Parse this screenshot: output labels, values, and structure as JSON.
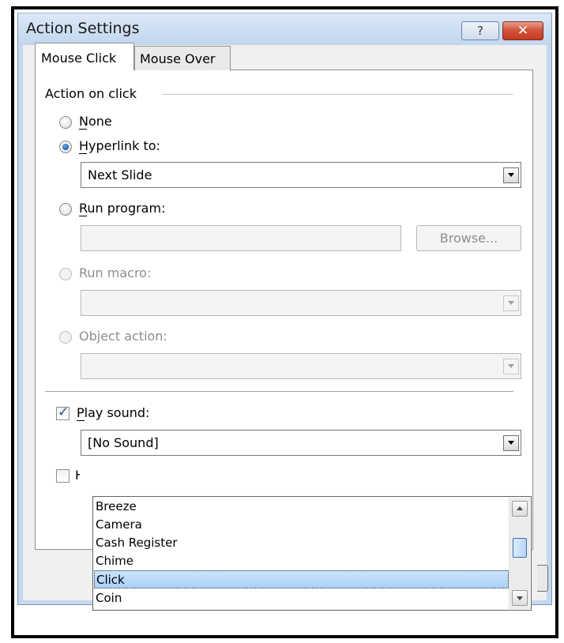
{
  "window": {
    "title": "Action Settings",
    "help_label": "?",
    "close_label": "✕"
  },
  "tabs": [
    {
      "label": "Mouse Click",
      "active": true
    },
    {
      "label": "Mouse Over",
      "active": false
    }
  ],
  "group": {
    "label": "Action on click"
  },
  "options": {
    "none": {
      "label": "None",
      "selected": false,
      "enabled": true
    },
    "hyperlink": {
      "label": "Hyperlink to:",
      "selected": true,
      "enabled": true,
      "value": "Next Slide"
    },
    "run_program": {
      "label": "Run program:",
      "selected": false,
      "enabled": true,
      "value": "",
      "browse_label": "Browse..."
    },
    "run_macro": {
      "label": "Run macro:",
      "selected": false,
      "enabled": false,
      "value": ""
    },
    "object_action": {
      "label": "Object action:",
      "selected": false,
      "enabled": false,
      "value": ""
    }
  },
  "play_sound": {
    "label": "Play sound:",
    "checked": true,
    "value": "[No Sound]"
  },
  "highlight": {
    "checked": false
  },
  "sound_list": {
    "items": [
      "Breeze",
      "Camera",
      "Cash Register",
      "Chime",
      "Click",
      "Coin"
    ],
    "selected": "Click"
  },
  "colors": {
    "selection": "#a9d1f7",
    "close_button": "#c43b1f",
    "titlebar": "#cfe0f3"
  }
}
